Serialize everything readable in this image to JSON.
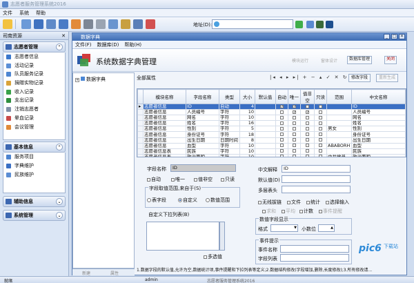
{
  "app": {
    "title": "志愿者服务管理系统2016"
  },
  "menubar": [
    "文件",
    "系统",
    "帮助"
  ],
  "address": {
    "label": "地址(D):"
  },
  "nav": {
    "title": "司南资源",
    "sections": [
      {
        "title": "志愿者管理",
        "items": [
          "志愿者信息",
          "活动记录",
          "队员服务记录",
          "捐赠实物记录",
          "收入记录",
          "支出记录",
          "注销志愿者",
          "晕血记录",
          "会议管理"
        ]
      },
      {
        "title": "基本信息",
        "items": [
          "服务项目",
          "字典维护",
          "民族维护"
        ]
      },
      {
        "title": "辅助信息",
        "items": []
      },
      {
        "title": "系统管理",
        "items": []
      }
    ]
  },
  "status": {
    "ready": "就绪",
    "user": "admin",
    "app": "志愿者服务管理系统2016"
  },
  "win": {
    "title": "数据字典",
    "menu": [
      "文件(F)",
      "数据库(D)",
      "帮助(H)"
    ],
    "header": {
      "title": "系统数据字典管理",
      "btn_run": "模块运行",
      "btn_design": "窗体设计",
      "btn_dbmgr": "数据库管理",
      "btn_close": "关闭"
    },
    "tree": {
      "root": "数据字典"
    },
    "treefoot": {
      "new": "新建",
      "props": "属性"
    },
    "props": {
      "title": "全部属性",
      "nav": "|◂ ◂ ▸ ▸| + − ▴ ✓ ✕ ↻",
      "btn_edit": "修改字段",
      "btn_regen": "重新生成"
    },
    "grid": {
      "columns": [
        "模块名称",
        "字段名称",
        "类型",
        "大小",
        "默认值",
        "自动",
        "唯一",
        "值非空",
        "只读",
        "范围",
        "中文名称"
      ],
      "rows": [
        [
          "志愿者信息",
          "ID",
          "自动",
          "4",
          "",
          true,
          true,
          false,
          false,
          "",
          "ID"
        ],
        [
          "志愿者信息",
          "人员编号",
          "字符",
          "10",
          "",
          false,
          true,
          true,
          false,
          "",
          "人员编号"
        ],
        [
          "志愿者信息",
          "网名",
          "字符",
          "10",
          "",
          false,
          false,
          false,
          false,
          "",
          "网名"
        ],
        [
          "志愿者信息",
          "姓名",
          "字符",
          "16",
          "",
          false,
          false,
          false,
          false,
          "",
          "姓名"
        ],
        [
          "志愿者信息",
          "性别",
          "字符",
          "5",
          "",
          false,
          false,
          false,
          false,
          "男女",
          "性别"
        ],
        [
          "志愿者信息",
          "身份证号",
          "字符",
          "18",
          "",
          false,
          false,
          false,
          false,
          "",
          "身份证号"
        ],
        [
          "志愿者信息",
          "出生日期",
          "日期时间",
          "8",
          "",
          false,
          false,
          false,
          false,
          "",
          "出生日期"
        ],
        [
          "志愿者信息",
          "血型",
          "字符",
          "10",
          "",
          false,
          false,
          false,
          false,
          "ABABORH",
          "血型"
        ],
        [
          "志愿者信息表",
          "民族",
          "字符",
          "10",
          "",
          false,
          false,
          false,
          false,
          "",
          "民族"
        ],
        [
          "志愿者信息表",
          "政治面貌",
          "字符",
          "10",
          "",
          false,
          false,
          false,
          false,
          "中共党员",
          "政治面貌"
        ]
      ]
    },
    "form": {
      "field_name_label": "字段名称",
      "field_name_value": "ID",
      "chk_auto": "自动",
      "chk_unique": "唯一",
      "chk_notnull": "值非空",
      "chk_readonly": "只读",
      "value_source_title": "字段取值范围,来自于(S)",
      "radio_table": "表字段",
      "radio_custom": "自定义",
      "radio_numeric": "数值范围",
      "custom_list_title": "自定义下拉列表(B)",
      "multi_select": "多选值",
      "cn_name_label": "中文解释",
      "cn_name_value": "ID",
      "default_label": "默认值(D)",
      "multi_header_label": "多层表头",
      "chk_nolink": "无线拔链",
      "chk_file": "文件",
      "chk_stat": "统计",
      "chk_select_input": "选择输入",
      "dis_sum": "求和",
      "dis_avg": "平均",
      "chk_count": "计数",
      "dis_event": "事件提醒",
      "numeric_title": "数值字段显示",
      "format_label": "格式",
      "decimal_label": "小数位",
      "event_title": "事件提示",
      "event_name_label": "事件名称",
      "field_list_label": "字段列表"
    },
    "note": "1.数据字段的默认值,允许为空,数据统计项,事件提醒和下拉列表等定义;2.数据结构修改(字段增加,删除,长度修改);3.所有修改请..."
  },
  "watermark": {
    "logo": "pic6",
    "sub": "下载站"
  },
  "colors": {
    "accent": "#3a6fc4",
    "titlebar": "#3e6db4",
    "nav_bg": "#dbe6f5"
  }
}
